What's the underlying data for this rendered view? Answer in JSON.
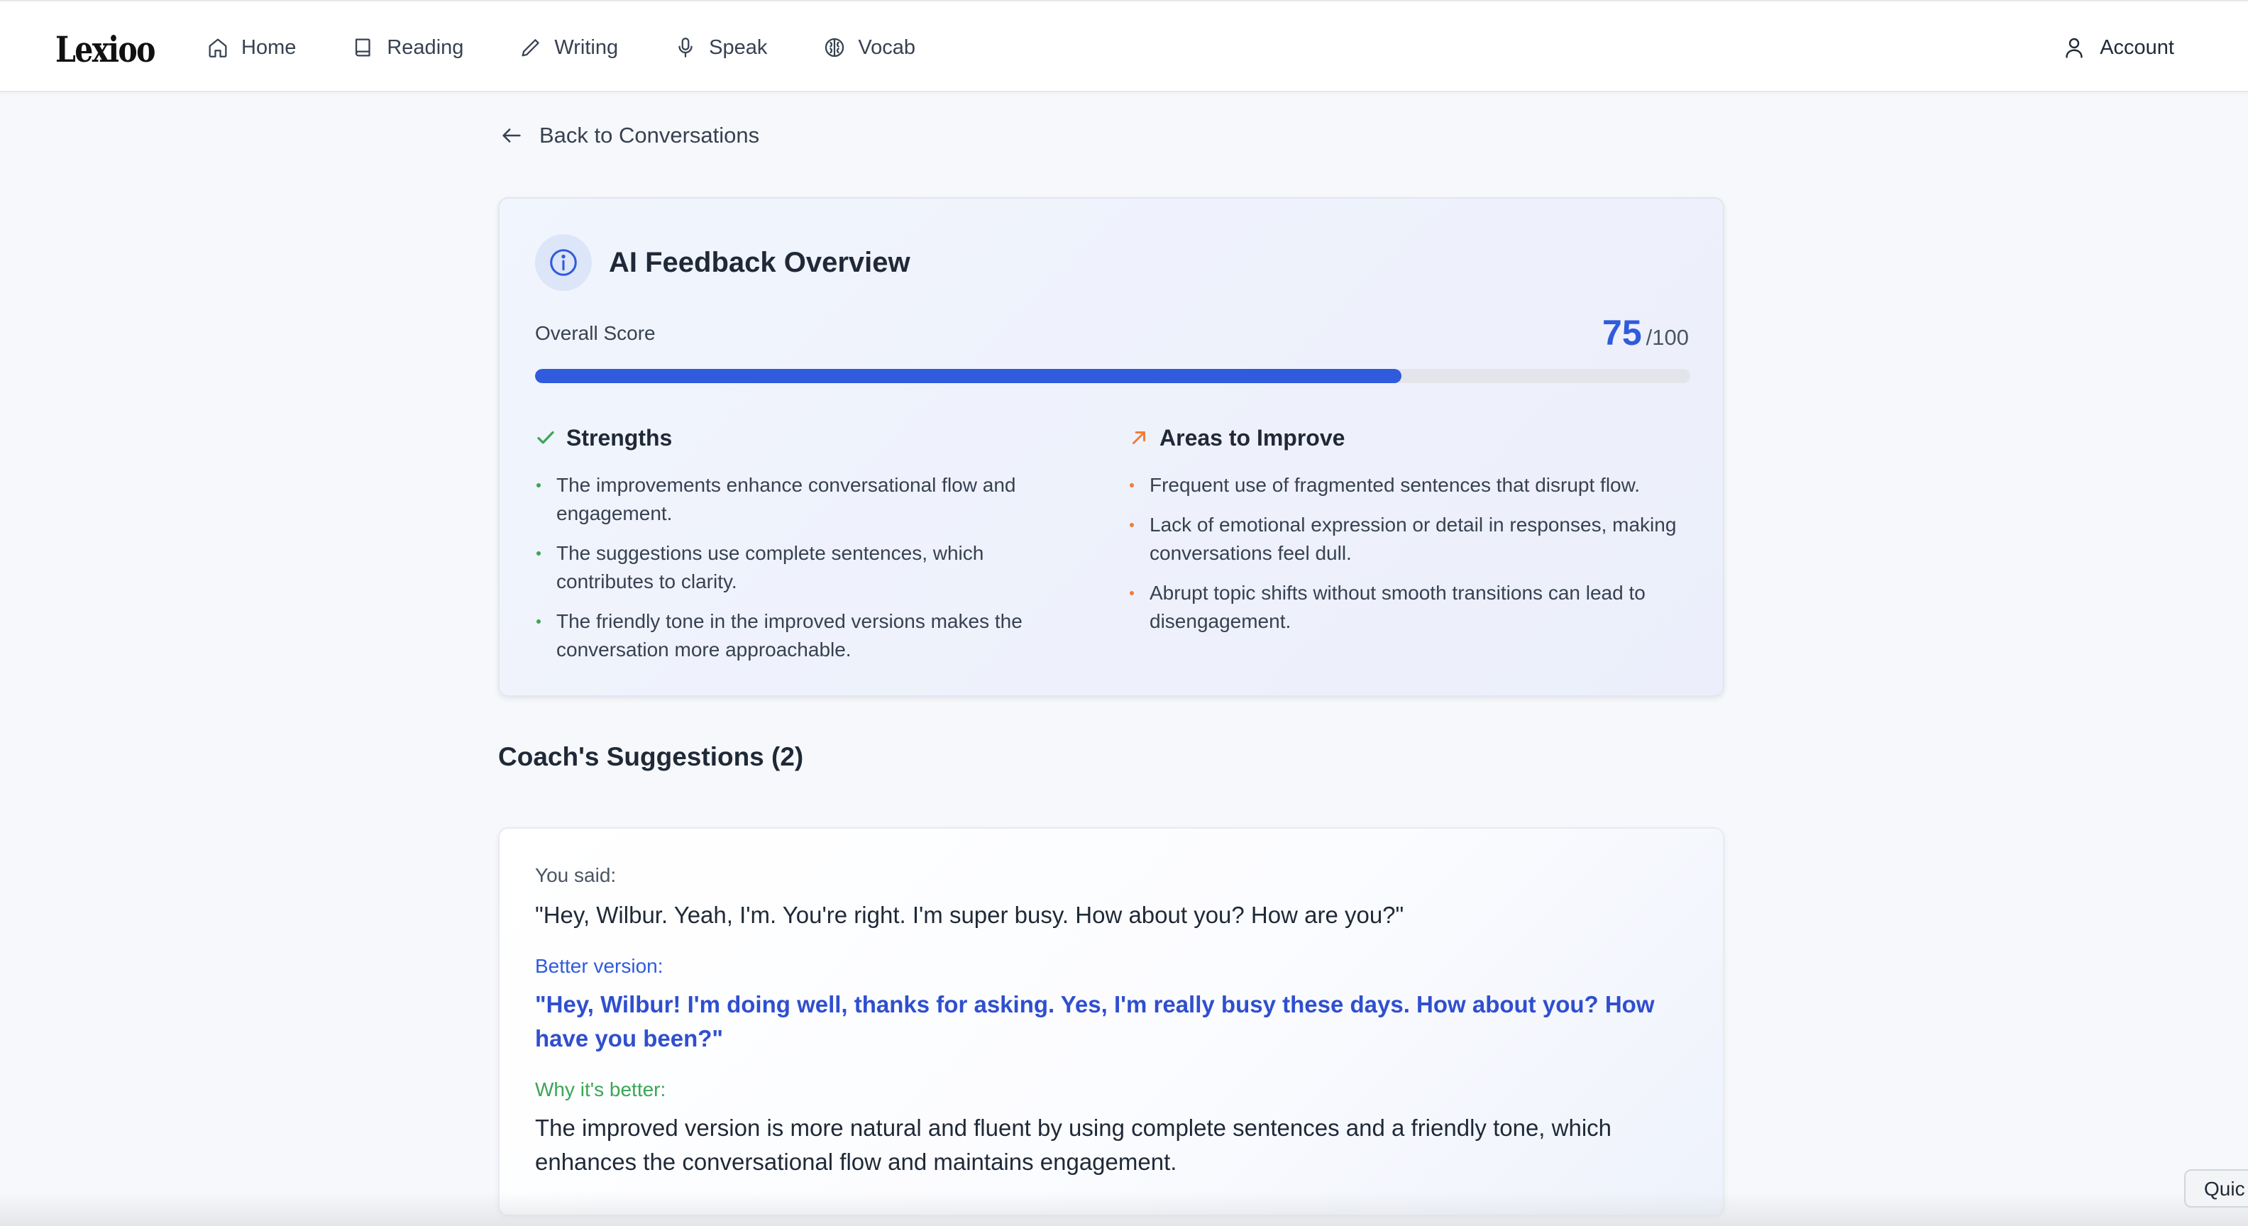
{
  "app": {
    "logo": "Lexioo"
  },
  "nav": {
    "items": [
      {
        "label": "Home",
        "icon": "home-icon"
      },
      {
        "label": "Reading",
        "icon": "book-icon"
      },
      {
        "label": "Writing",
        "icon": "pencil-icon"
      },
      {
        "label": "Speak",
        "icon": "microphone-icon"
      },
      {
        "label": "Vocab",
        "icon": "brain-icon"
      }
    ],
    "account": {
      "label": "Account",
      "icon": "user-icon"
    }
  },
  "back": {
    "label": "Back to Conversations",
    "icon": "arrow-left-icon"
  },
  "feedback": {
    "title": "AI Feedback Overview",
    "score_label": "Overall Score",
    "score": "75",
    "score_max": "/100",
    "score_fraction": 0.75,
    "strengths": {
      "title": "Strengths",
      "items": [
        "The improvements enhance conversational flow and engagement.",
        "The suggestions use complete sentences, which contributes to clarity.",
        "The friendly tone in the improved versions makes the conversation more approachable."
      ]
    },
    "improve": {
      "title": "Areas to Improve",
      "items": [
        "Frequent use of fragmented sentences that disrupt flow.",
        "Lack of emotional expression or detail in responses, making conversations feel dull.",
        "Abrupt topic shifts without smooth transitions can lead to disengagement."
      ]
    }
  },
  "suggestions": {
    "title": "Coach's Suggestions (2)",
    "items": [
      {
        "said_label": "You said:",
        "said": "\"Hey, Wilbur. Yeah, I'm. You're right. I'm super busy. How about you? How are you?\"",
        "better_label": "Better version:",
        "better": "\"Hey, Wilbur! I'm doing well, thanks for asking. Yes, I'm really busy these days. How about you? How have you been?\"",
        "why_label": "Why it's better:",
        "why": "The improved version is more natural and fluent by using complete sentences and a friendly tone, which enhances the conversational flow and maintains engagement."
      }
    ]
  },
  "quick_button": {
    "label": "Quic"
  },
  "colors": {
    "accent": "#2f5bdc",
    "success": "#3aa655",
    "warning": "#ef7d3a",
    "background": "#f7f8fb"
  }
}
